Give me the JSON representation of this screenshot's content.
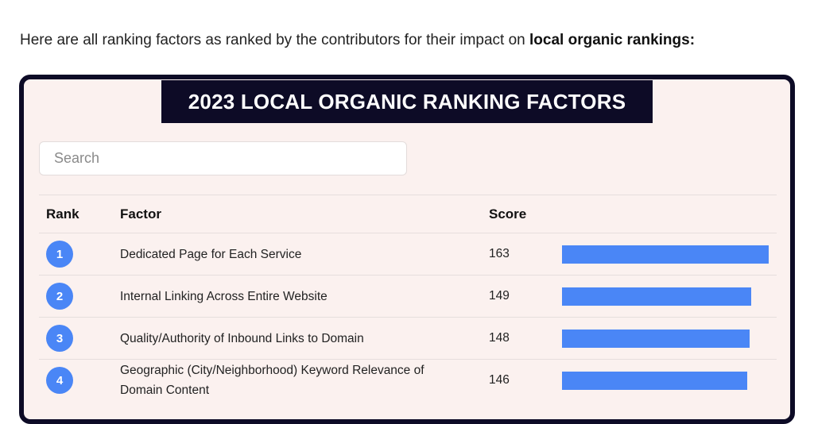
{
  "intro": {
    "text": "Here are all ranking factors as ranked by the contributors for their impact on ",
    "bold": "local organic rankings:"
  },
  "card": {
    "title": "2023 LOCAL ORGANIC RANKING FACTORS",
    "search_placeholder": "Search"
  },
  "table": {
    "headers": {
      "rank": "Rank",
      "factor": "Factor",
      "score": "Score"
    },
    "max_score": 163,
    "bar_color": "#4a86f6",
    "rows": [
      {
        "rank": "1",
        "factor": "Dedicated Page for Each Service",
        "score": "163",
        "value": 163
      },
      {
        "rank": "2",
        "factor": "Internal Linking Across Entire Website",
        "score": "149",
        "value": 149
      },
      {
        "rank": "3",
        "factor": "Quality/Authority of Inbound Links to Domain",
        "score": "148",
        "value": 148
      },
      {
        "rank": "4",
        "factor": "Geographic (City/Neighborhood) Keyword Relevance of Domain Content",
        "score": "146",
        "value": 146
      }
    ]
  }
}
